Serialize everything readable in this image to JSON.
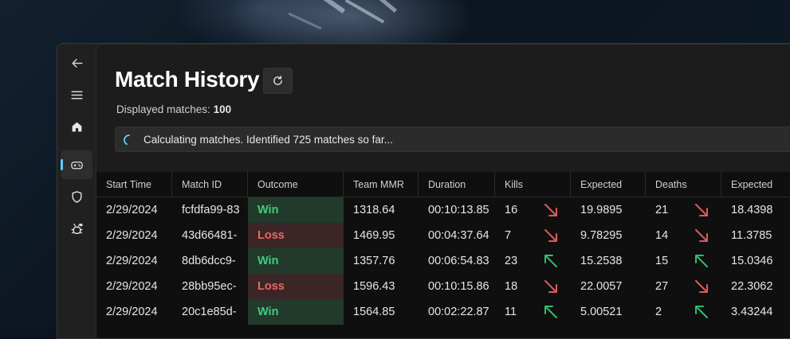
{
  "page": {
    "title": "Match History",
    "displayed_label": "Displayed matches:",
    "displayed_count": "100",
    "progress_message": "Calculating matches. Identified 725 matches so far..."
  },
  "nav": {
    "items": [
      "back-icon",
      "hamburger-menu-icon",
      "home-icon",
      "gamepad-icon",
      "shield-icon",
      "settings-bug-icon"
    ],
    "selected": "gamepad-icon"
  },
  "table": {
    "headers": {
      "start_time": "Start Time",
      "match_id": "Match ID",
      "outcome": "Outcome",
      "team_mmr": "Team MMR",
      "duration": "Duration",
      "kills": "Kills",
      "expected_kills": "Expected",
      "deaths": "Deaths",
      "expected_deaths": "Expected"
    },
    "rows": [
      {
        "start_time": "2/29/2024",
        "match_id": "fcfdfa99-83",
        "outcome": "Win",
        "team_mmr": "1318.64",
        "duration": "00:10:13.85",
        "kills": "16",
        "kills_trend": "down",
        "expected_kills": "19.9895",
        "deaths": "21",
        "deaths_trend": "down",
        "expected_deaths": "18.4398"
      },
      {
        "start_time": "2/29/2024",
        "match_id": "43d66481-",
        "outcome": "Loss",
        "team_mmr": "1469.95",
        "duration": "00:04:37.64",
        "kills": "7",
        "kills_trend": "down",
        "expected_kills": "9.78295",
        "deaths": "14",
        "deaths_trend": "down",
        "expected_deaths": "11.3785"
      },
      {
        "start_time": "2/29/2024",
        "match_id": "8db6dcc9-",
        "outcome": "Win",
        "team_mmr": "1357.76",
        "duration": "00:06:54.83",
        "kills": "23",
        "kills_trend": "up",
        "expected_kills": "15.2538",
        "deaths": "15",
        "deaths_trend": "up",
        "expected_deaths": "15.0346"
      },
      {
        "start_time": "2/29/2024",
        "match_id": "28bb95ec-",
        "outcome": "Loss",
        "team_mmr": "1596.43",
        "duration": "00:10:15.86",
        "kills": "18",
        "kills_trend": "down",
        "expected_kills": "22.0057",
        "deaths": "27",
        "deaths_trend": "down",
        "expected_deaths": "22.3062"
      },
      {
        "start_time": "2/29/2024",
        "match_id": "20c1e85d-",
        "outcome": "Win",
        "team_mmr": "1564.85",
        "duration": "00:02:22.87",
        "kills": "11",
        "kills_trend": "up",
        "expected_kills": "5.00521",
        "deaths": "2",
        "deaths_trend": "up",
        "expected_deaths": "3.43244"
      }
    ]
  },
  "colors": {
    "accent": "#60cdff",
    "win_text": "#3fce7a",
    "loss_text": "#e8685f",
    "trend_up": "#2fbf71",
    "trend_down": "#e05a5a"
  }
}
